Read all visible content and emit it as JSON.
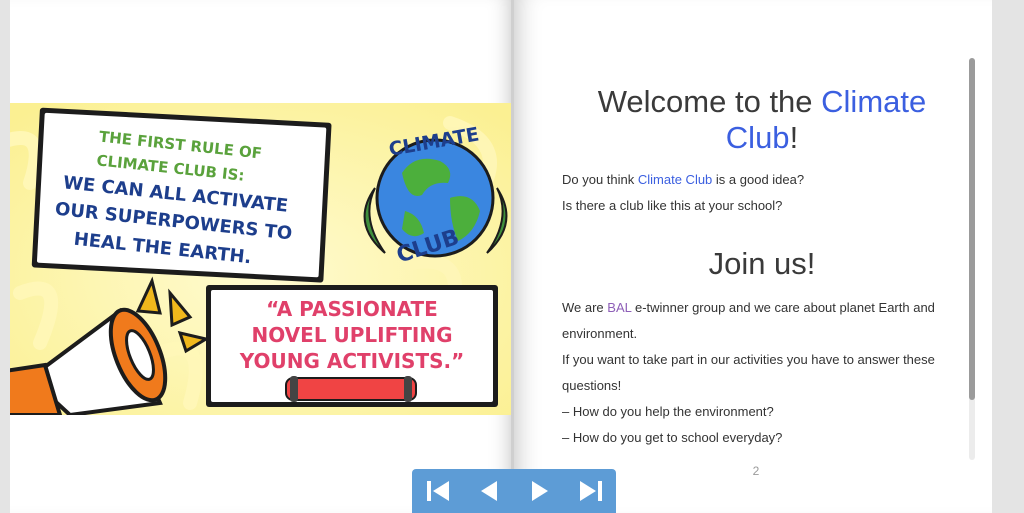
{
  "poster": {
    "rule_line1": "THE FIRST RULE OF",
    "rule_line2": "CLIMATE CLUB IS:",
    "rule_bold1": "WE CAN ALL ACTIVATE",
    "rule_bold2": "OUR SUPERPOWERS TO",
    "rule_bold3": "HEAL THE EARTH.",
    "logo_top": "CLIMATE",
    "logo_bottom": "CLUB",
    "quote1": "“A PASSIONATE",
    "quote2": "NOVEL UPLIFTING",
    "quote3": "YOUNG ACTIVISTS.”"
  },
  "page": {
    "title_prefix": "Welcome to the ",
    "title_highlight": "Climate Club",
    "title_suffix": "!",
    "q1_prefix": "Do you think ",
    "q1_highlight": "Climate Club",
    "q1_suffix": " is a good idea?",
    "q2": "Is there a club like this at your school?",
    "join_heading": "Join us!",
    "p1_prefix": "We are ",
    "p1_highlight": "BAL",
    "p1_suffix": " e-twinner group and we care about planet Earth and",
    "p1_line2": "environment.",
    "p2_line1": "If you want to take part in our activities you have to answer these",
    "p2_line2": "questions!",
    "bullet1": "– How do you help the environment?",
    "bullet2": "– How do you get to school everyday?",
    "page_number": "2"
  },
  "colors": {
    "accent_blue": "#3b5fe0",
    "bal_purple": "#8e5fb8",
    "nav_blue": "#5d9cd6",
    "poster_yellow": "#fdf7a8",
    "poster_green": "#5aa23c",
    "poster_navy": "#1d3e8c",
    "poster_pink": "#e0406a"
  },
  "nav": {
    "first_icon": "first-page-icon",
    "prev_icon": "previous-page-icon",
    "next_icon": "next-page-icon",
    "last_icon": "last-page-icon"
  }
}
